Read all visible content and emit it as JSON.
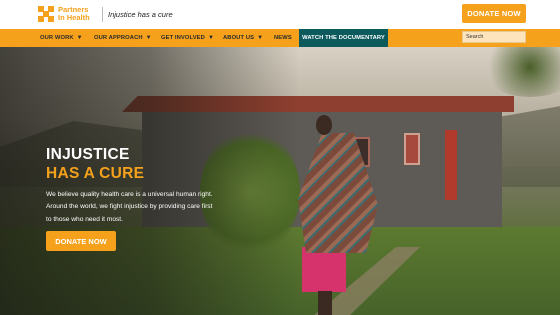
{
  "header": {
    "logo_line1": "Partners",
    "logo_line2": "In Health",
    "tagline": "Injustice has a cure",
    "donate_label": "DONATE NOW"
  },
  "nav": {
    "items": [
      {
        "label": "OUR WORK",
        "has_caret": true
      },
      {
        "label": "OUR APPROACH",
        "has_caret": true
      },
      {
        "label": "GET INVOLVED",
        "has_caret": true
      },
      {
        "label": "ABOUT US",
        "has_caret": true
      },
      {
        "label": "NEWS",
        "has_caret": false
      }
    ],
    "caret": "▼",
    "cta_label": "WATCH THE DOCUMENTARY",
    "search_placeholder": "Search"
  },
  "hero": {
    "title_line1": "INJUSTICE",
    "title_line2": "HAS A CURE",
    "body_line1": "We believe quality health care is a universal human right.",
    "body_line2": "Around the world, we fight injustice by providing care first",
    "body_line3": "to those who need it most.",
    "donate_label": "DONATE NOW"
  },
  "colors": {
    "brand_orange": "#f5a11c",
    "nav_teal": "#0d5a5c"
  }
}
